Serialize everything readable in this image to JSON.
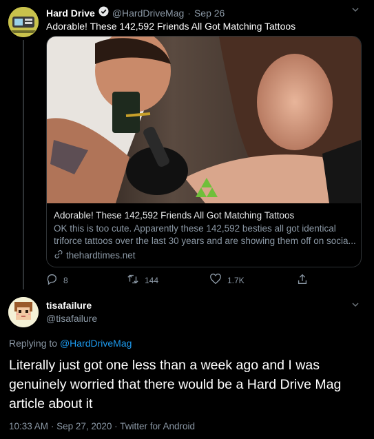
{
  "tweet": {
    "author_name": "Hard Drive",
    "verified_icon": "verified-badge-icon",
    "handle": "@HardDriveMag",
    "date": "Sep 26",
    "text": "Adorable! These 142,592 Friends All Got Matching Tattoos",
    "card": {
      "title": "Adorable! These 142,592 Friends All Got Matching Tattoos",
      "description_line1": "OK this is too cute. Apparently these 142,592 besties all got identical",
      "description_line2": "triforce tattoos over the last 30 years and are showing them off on socia...",
      "domain": "thehardtimes.net"
    },
    "actions": {
      "replies": "8",
      "retweets": "144",
      "likes": "1.7K"
    }
  },
  "reply": {
    "author_name": "tisafailure",
    "handle": "@tisafailure",
    "replying_to_label": "Replying to",
    "replying_to_handle": "@HardDriveMag",
    "text": "Literally just got one less than a week ago and  I was genuinely worried that there would be a Hard Drive Mag article about it",
    "time": "10:33 AM",
    "date": "Sep 27, 2020",
    "client": "Twitter for Android"
  },
  "colors": {
    "background": "#000000",
    "link": "#1d9bf0",
    "muted": "#8b98a5",
    "triforce": "#6fbf3a"
  }
}
